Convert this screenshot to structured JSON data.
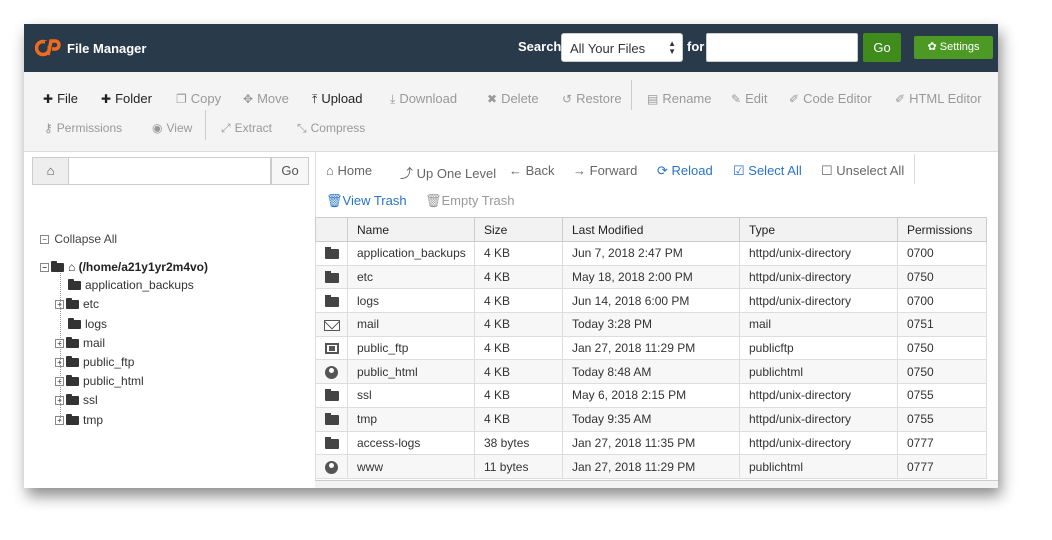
{
  "header": {
    "app_title": "File Manager",
    "search_label": "Search",
    "search_scope": "All Your Files",
    "for_label": "for",
    "search_value": "",
    "go_label": "Go",
    "settings_label": "Settings",
    "settings_icon": "gear-icon"
  },
  "toolbar": {
    "file": "File",
    "folder": "Folder",
    "copy": "Copy",
    "move": "Move",
    "upload": "Upload",
    "download": "Download",
    "delete": "Delete",
    "restore": "Restore",
    "rename": "Rename",
    "edit": "Edit",
    "code_editor": "Code Editor",
    "html_editor": "HTML Editor",
    "permissions": "Permissions",
    "view": "View",
    "extract": "Extract",
    "compress": "Compress"
  },
  "left": {
    "go_label": "Go",
    "search_value": "",
    "collapse_all": "Collapse All",
    "root": "(/home/a21y1yr2m4vo)",
    "tree": [
      "application_backups",
      "etc",
      "logs",
      "mail",
      "public_ftp",
      "public_html",
      "ssl",
      "tmp"
    ]
  },
  "nav": {
    "home": "Home",
    "up": "Up One Level",
    "back": "Back",
    "forward": "Forward",
    "reload": "Reload",
    "select_all": "Select All",
    "unselect_all": "Unselect All",
    "view_trash": "View Trash",
    "empty_trash": "Empty Trash"
  },
  "table": {
    "columns": [
      "Name",
      "Size",
      "Last Modified",
      "Type",
      "Permissions"
    ],
    "rows": [
      {
        "icon": "folder-icon",
        "name": "application_backups",
        "size": "4 KB",
        "modified": "Jun 7, 2018 2:47 PM",
        "type": "httpd/unix-directory",
        "perms": "0700"
      },
      {
        "icon": "folder-icon",
        "name": "etc",
        "size": "4 KB",
        "modified": "May 18, 2018 2:00 PM",
        "type": "httpd/unix-directory",
        "perms": "0750"
      },
      {
        "icon": "folder-icon",
        "name": "logs",
        "size": "4 KB",
        "modified": "Jun 14, 2018 6:00 PM",
        "type": "httpd/unix-directory",
        "perms": "0700"
      },
      {
        "icon": "mail-icon",
        "name": "mail",
        "size": "4 KB",
        "modified": "Today 3:28 PM",
        "type": "mail",
        "perms": "0751"
      },
      {
        "icon": "ftp-icon",
        "name": "public_ftp",
        "size": "4 KB",
        "modified": "Jan 27, 2018 11:29 PM",
        "type": "publicftp",
        "perms": "0750"
      },
      {
        "icon": "globe-icon",
        "name": "public_html",
        "size": "4 KB",
        "modified": "Today 8:48 AM",
        "type": "publichtml",
        "perms": "0750"
      },
      {
        "icon": "folder-icon",
        "name": "ssl",
        "size": "4 KB",
        "modified": "May 6, 2018 2:15 PM",
        "type": "httpd/unix-directory",
        "perms": "0755"
      },
      {
        "icon": "folder-icon",
        "name": "tmp",
        "size": "4 KB",
        "modified": "Today 9:35 AM",
        "type": "httpd/unix-directory",
        "perms": "0755"
      },
      {
        "icon": "folder-icon",
        "name": "access-logs",
        "size": "38 bytes",
        "modified": "Jan 27, 2018 11:35 PM",
        "type": "httpd/unix-directory",
        "perms": "0777"
      },
      {
        "icon": "globe-icon",
        "name": "www",
        "size": "11 bytes",
        "modified": "Jan 27, 2018 11:29 PM",
        "type": "publichtml",
        "perms": "0777"
      }
    ]
  },
  "colors": {
    "topbar": "#293a4a",
    "go_green": "#3f8b1b",
    "logo_orange": "#f26b1d",
    "link_blue": "#2a74c7"
  }
}
